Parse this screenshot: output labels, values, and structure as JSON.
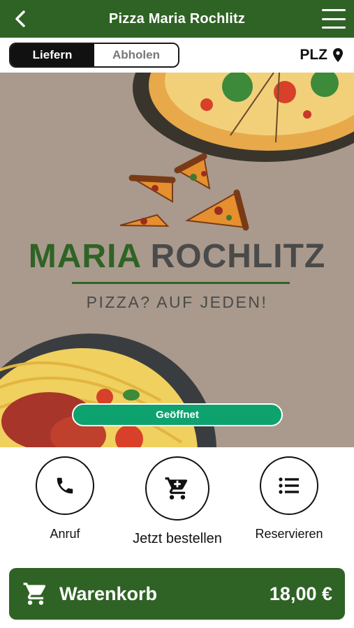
{
  "header": {
    "title": "Pizza Maria Rochlitz"
  },
  "mode_toggle": {
    "deliver_label": "Liefern",
    "pickup_label": "Abholen",
    "active": "Liefern"
  },
  "location": {
    "plz_label": "PLZ"
  },
  "hero": {
    "brand_part1": "MARIA",
    "brand_part2": "ROCHLITZ",
    "tagline": "PIZZA? AUF JEDEN!",
    "status": "Geöffnet"
  },
  "actions": [
    {
      "label": "Anruf",
      "icon": "phone-icon"
    },
    {
      "label": "Jetzt bestellen",
      "icon": "cart-icon"
    },
    {
      "label": "Reservieren",
      "icon": "list-icon"
    }
  ],
  "cart": {
    "label": "Warenkorb",
    "total": "18,00 €"
  },
  "colors": {
    "brand_green": "#2f6325",
    "status_green": "#0ea26f",
    "hero_bg": "#a99a8d"
  }
}
